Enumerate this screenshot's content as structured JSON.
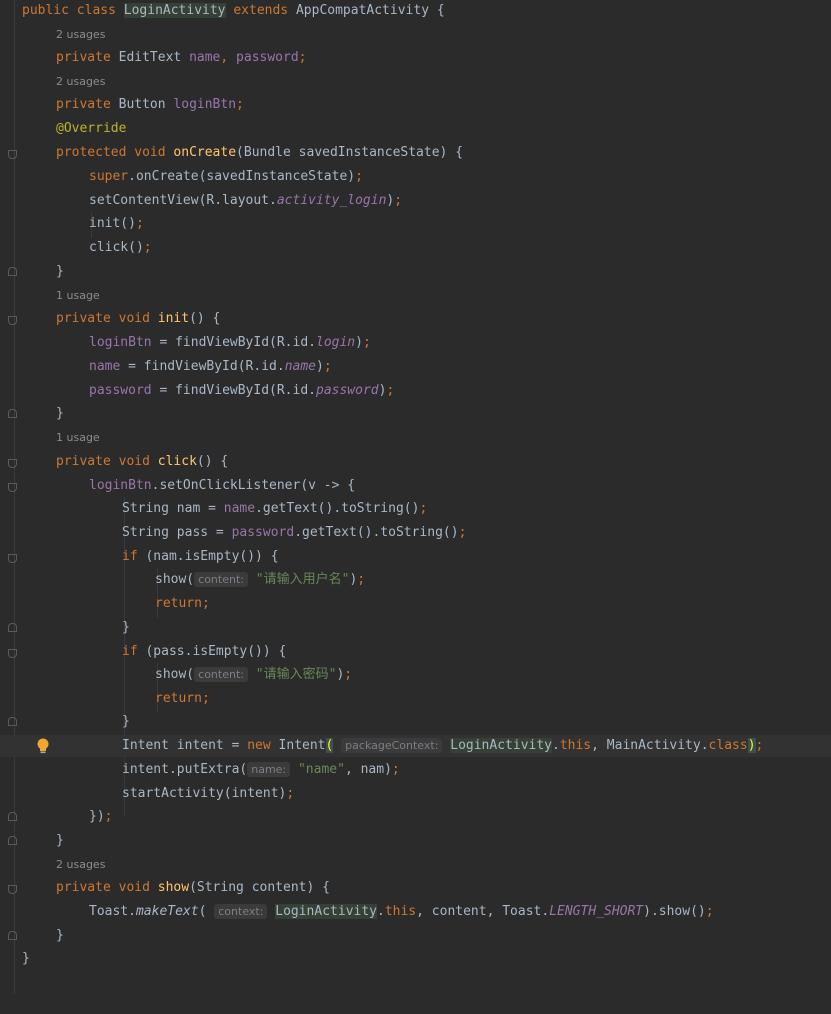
{
  "code": {
    "class_decl": {
      "kw1": "public",
      "kw2": "class",
      "name": "LoginActivity",
      "kw3": "extends",
      "parent": "AppCompatActivity",
      "brace": "{"
    },
    "usage1": "2 usages",
    "field1": {
      "kw": "private",
      "type": "EditText",
      "f1": "name",
      "sep": ", ",
      "f2": "password",
      "end": ";"
    },
    "usage2": "2 usages",
    "field2": {
      "kw": "private",
      "type": "Button",
      "f1": "loginBtn",
      "end": ";"
    },
    "override": "@Override",
    "oncreate_sig": {
      "kw1": "protected",
      "kw2": "void",
      "name": "onCreate",
      "params": "(Bundle savedInstanceState) {"
    },
    "super_call": {
      "kw": "super",
      ".": ".",
      "rest": "onCreate(savedInstanceState)",
      "end": ";"
    },
    "set_content": {
      "a": "setContentView(R.layout.",
      "b": "activity_login",
      "c": ")",
      "end": ";"
    },
    "init_call": {
      "a": "init()",
      "end": ";"
    },
    "click_call": {
      "a": "click()",
      "end": ";"
    },
    "close1": "}",
    "usage3": "1 usage",
    "init_sig": {
      "kw1": "private",
      "kw2": "void",
      "name": "init",
      "params": "() {"
    },
    "init_l1": {
      "f": "loginBtn",
      "a": " = findViewById(R.id.",
      "b": "login",
      "c": ")",
      "end": ";"
    },
    "init_l2": {
      "f": "name",
      "a": " = findViewById(R.id.",
      "b": "name",
      "c": ")",
      "end": ";"
    },
    "init_l3": {
      "f": "password",
      "a": " = findViewById(R.id.",
      "b": "password",
      "c": ")",
      "end": ";"
    },
    "close2": "}",
    "usage4": "1 usage",
    "click_sig": {
      "kw1": "private",
      "kw2": "void",
      "name": "click",
      "params": "() {"
    },
    "listener": {
      "f": "loginBtn",
      "a": ".setOnClickListener(v -> {"
    },
    "nam_line": {
      "a": "String nam = ",
      "f": "name",
      "b": ".getText().toString()",
      "end": ";"
    },
    "pass_line": {
      "a": "String pass = ",
      "f": "password",
      "b": ".getText().toString()",
      "end": ";"
    },
    "if1": {
      "kw": "if",
      "a": " (nam.isEmpty()) {"
    },
    "show1": {
      "a": "show(",
      "hint": "content:",
      "s": "\"请输入用户名\"",
      "b": ")",
      "end": ";"
    },
    "ret1": {
      "kw": "return",
      "end": ";"
    },
    "close3": "}",
    "if2": {
      "kw": "if",
      "a": " (pass.isEmpty()) {"
    },
    "show2": {
      "a": "show(",
      "hint": "content:",
      "s": "\"请输入密码\"",
      "b": ")",
      "end": ";"
    },
    "ret2": {
      "kw": "return",
      "end": ";"
    },
    "close4": "}",
    "intent_line": {
      "a": "Intent intent = ",
      "kw": "new",
      "b": " Intent",
      "p1": "(",
      "hint": "packageContext:",
      "cls": "LoginActivity",
      "dot1": ".",
      "this": "this",
      "sep": ", MainActivity.",
      "class": "class",
      "p2": ")",
      "end": ";"
    },
    "putextra": {
      "a": "intent.putExtra(",
      "hint": "name:",
      "s": "\"name\"",
      "b": ", nam)",
      "end": ";"
    },
    "start_act": {
      "a": "startActivity(intent)",
      "end": ";"
    },
    "close5": {
      "a": "})",
      "end": ";"
    },
    "close6": "}",
    "usage5": "2 usages",
    "show_sig": {
      "kw1": "private",
      "kw2": "void",
      "name": "show",
      "params": "(String content) {"
    },
    "toast_line": {
      "a": "Toast.",
      "m": "makeText",
      "b": "(",
      "hint": "context:",
      "cls": "LoginActivity",
      "dot": ".",
      "this": "this",
      "c": ", content, Toast.",
      "const": "LENGTH_SHORT",
      "d": ").show()",
      "end": ";"
    },
    "close7": "}",
    "close8": "}"
  },
  "icons": {
    "intention": "lightbulb-icon",
    "fold": "fold-marker-icon"
  },
  "colors": {
    "background": "#2b2b2b",
    "keyword": "#cc7832",
    "field": "#9876aa",
    "method": "#ffc66d",
    "string": "#6a8759",
    "annotation": "#bbb529",
    "text": "#a9b7c6"
  }
}
